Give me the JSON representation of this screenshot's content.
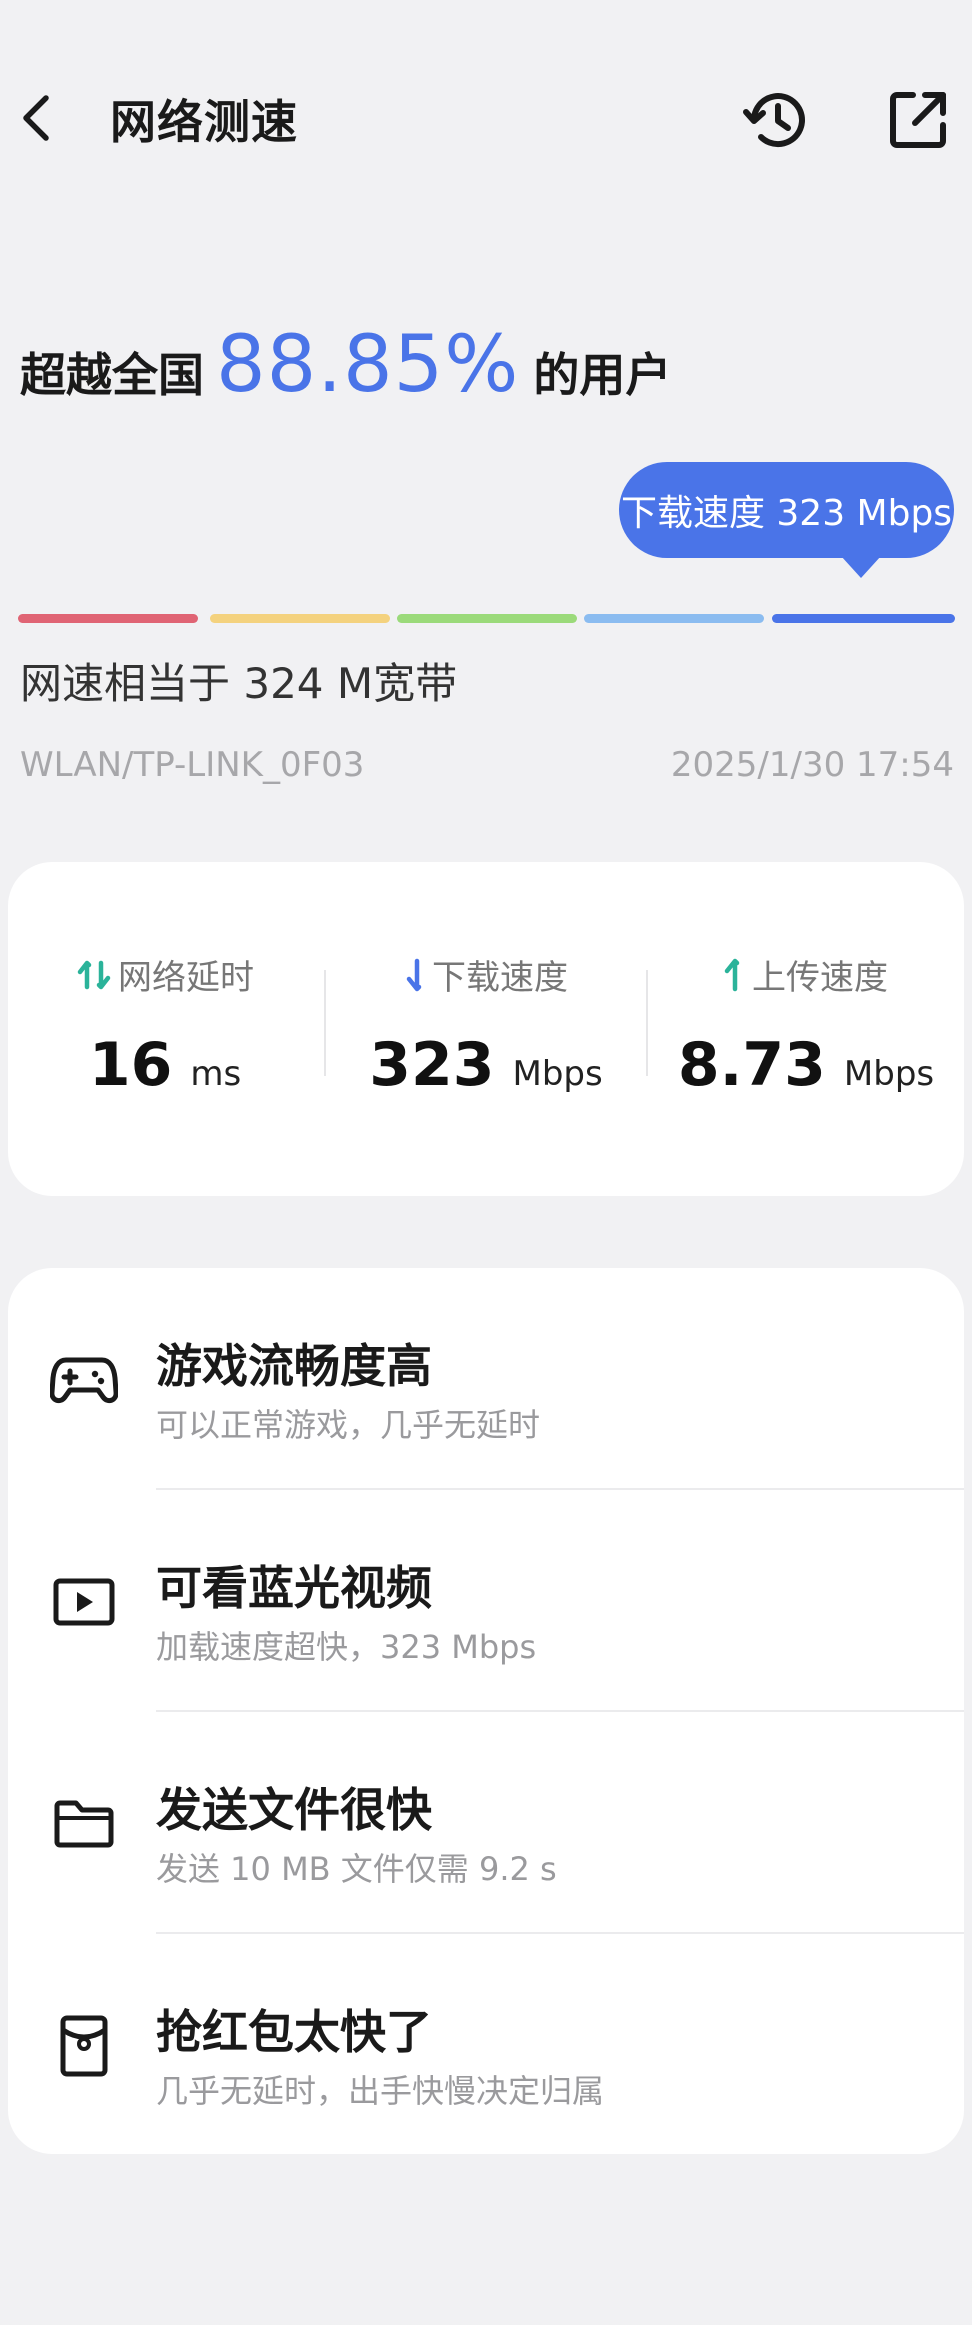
{
  "header": {
    "title": "网络测速",
    "icons": {
      "back": "back-chevron-icon",
      "history": "history-icon",
      "share": "share-icon"
    }
  },
  "result": {
    "prefix": "超越全国",
    "percentage": "88.85%",
    "suffix": "的用户",
    "bubble": "下载速度 323 Mbps",
    "equivalence": "网速相当于 324 M宽带",
    "network": "WLAN/TP-LINK_0F03",
    "datetime": "2025/1/30 17:54",
    "gauge_colors": [
      "#e06474",
      "#f4d27e",
      "#9bda7a",
      "#8bbcf0",
      "#4a74e8"
    ],
    "accent": "#4a74e8"
  },
  "stats": [
    {
      "label": "网络延时",
      "value": "16",
      "unit": "ms",
      "icon": "latency-arrows-icon"
    },
    {
      "label": "下载速度",
      "value": "323",
      "unit": "Mbps",
      "icon": "download-arrow-icon"
    },
    {
      "label": "上传速度",
      "value": "8.73",
      "unit": "Mbps",
      "icon": "upload-arrow-icon"
    }
  ],
  "features": [
    {
      "title": "游戏流畅度高",
      "desc": "可以正常游戏，几乎无延时",
      "icon": "gamepad-icon"
    },
    {
      "title": "可看蓝光视频",
      "desc": "加载速度超快，323 Mbps",
      "icon": "video-play-icon"
    },
    {
      "title": "发送文件很快",
      "desc": "发送 10 MB 文件仅需 9.2 s",
      "icon": "folder-icon"
    },
    {
      "title": "抢红包太快了",
      "desc": "几乎无延时，出手快慢决定归属",
      "icon": "red-envelope-icon"
    }
  ]
}
